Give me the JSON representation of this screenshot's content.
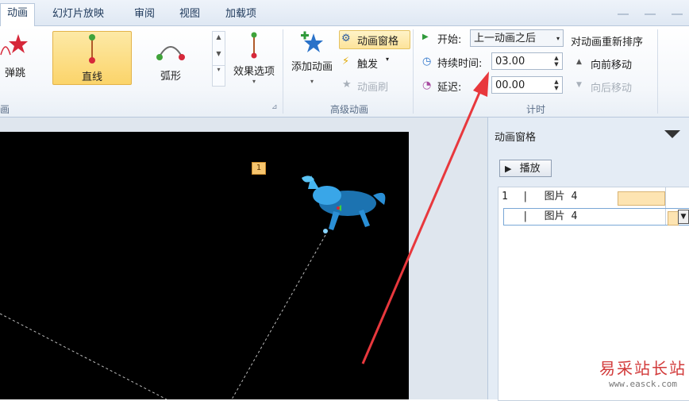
{
  "tabs": [
    {
      "label": "动画",
      "active": true
    },
    {
      "label": "幻灯片放映",
      "active": false
    },
    {
      "label": "审阅",
      "active": false
    },
    {
      "label": "视图",
      "active": false
    },
    {
      "label": "加载项",
      "active": false
    }
  ],
  "ribbon": {
    "gallery": {
      "items": [
        {
          "label": "弹跳",
          "icon": "bounce-star-icon",
          "selected": false
        },
        {
          "label": "直线",
          "icon": "line-path-icon",
          "selected": true
        },
        {
          "label": "弧形",
          "icon": "arc-path-icon",
          "selected": false
        }
      ],
      "group_label": "画"
    },
    "effect_options": {
      "label": "效果选项",
      "icon": "effect-options-icon"
    },
    "advanced": {
      "add_animation": "添加动画",
      "animation_pane": "动画窗格",
      "trigger": "触发",
      "animation_painter": "动画刷",
      "group_label": "高级动画"
    },
    "timing": {
      "start_label": "开始:",
      "start_value": "上一动画之后",
      "duration_label": "持续时间:",
      "duration_value": "03.00",
      "delay_label": "延迟:",
      "delay_value": "00.00",
      "reorder_title": "对动画重新排序",
      "move_earlier": "向前移动",
      "move_later": "向后移动",
      "group_label": "计时"
    }
  },
  "slide": {
    "anim_tag": "1"
  },
  "pane": {
    "title": "动画窗格",
    "play": "播放",
    "items": [
      {
        "number": "1",
        "name": "图片 4"
      },
      {
        "number": "",
        "name": "图片 4"
      }
    ]
  },
  "annotation_color": "#e8383d",
  "watermark": {
    "title": "易采站长站",
    "url": "www.easck.com"
  }
}
